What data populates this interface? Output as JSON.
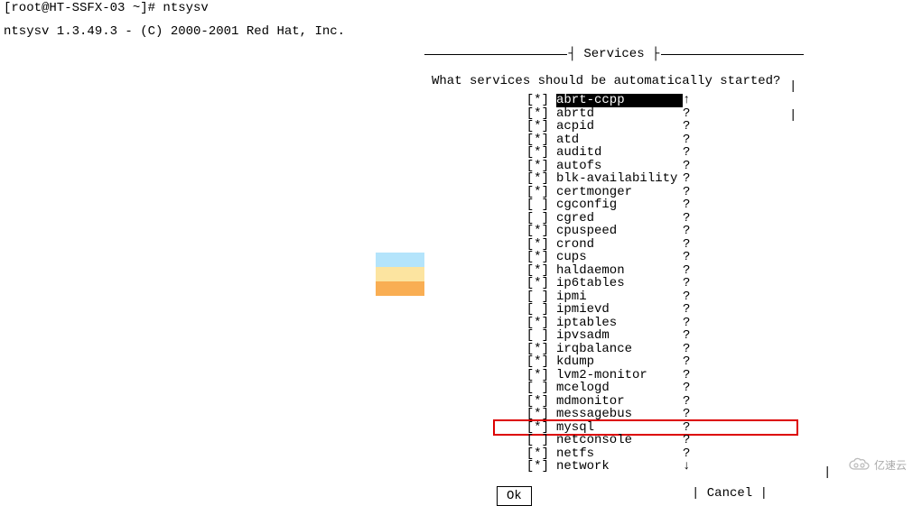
{
  "terminal": {
    "prompt_line": "[root@HT-SSFX-03 ~]# ntsysv",
    "version_line": "ntsysv 1.3.49.3 - (C) 2000-2001 Red Hat, Inc."
  },
  "dialog": {
    "title": "┤ Services ├",
    "prompt": "What services should be automatically started?",
    "services": [
      {
        "box": "[*]",
        "name": "abrt-ccpp",
        "ind": "↑",
        "selected": true,
        "highlight": false
      },
      {
        "box": "[*]",
        "name": "abrtd",
        "ind": "?",
        "selected": false,
        "highlight": false
      },
      {
        "box": "[*]",
        "name": "acpid",
        "ind": "?",
        "selected": false,
        "highlight": false
      },
      {
        "box": "[*]",
        "name": "atd",
        "ind": "?",
        "selected": false,
        "highlight": false
      },
      {
        "box": "[*]",
        "name": "auditd",
        "ind": "?",
        "selected": false,
        "highlight": false
      },
      {
        "box": "[*]",
        "name": "autofs",
        "ind": "?",
        "selected": false,
        "highlight": false
      },
      {
        "box": "[*]",
        "name": "blk-availability",
        "ind": "?",
        "selected": false,
        "highlight": false
      },
      {
        "box": "[*]",
        "name": "certmonger",
        "ind": "?",
        "selected": false,
        "highlight": false
      },
      {
        "box": "[ ]",
        "name": "cgconfig",
        "ind": "?",
        "selected": false,
        "highlight": false
      },
      {
        "box": "[ ]",
        "name": "cgred",
        "ind": "?",
        "selected": false,
        "highlight": false
      },
      {
        "box": "[*]",
        "name": "cpuspeed",
        "ind": "?",
        "selected": false,
        "highlight": false
      },
      {
        "box": "[*]",
        "name": "crond",
        "ind": "?",
        "selected": false,
        "highlight": false
      },
      {
        "box": "[*]",
        "name": "cups",
        "ind": "?",
        "selected": false,
        "highlight": false
      },
      {
        "box": "[*]",
        "name": "haldaemon",
        "ind": "?",
        "selected": false,
        "highlight": false
      },
      {
        "box": "[*]",
        "name": "ip6tables",
        "ind": "?",
        "selected": false,
        "highlight": false
      },
      {
        "box": "[ ]",
        "name": "ipmi",
        "ind": "?",
        "selected": false,
        "highlight": false
      },
      {
        "box": "[ ]",
        "name": "ipmievd",
        "ind": "?",
        "selected": false,
        "highlight": false
      },
      {
        "box": "[*]",
        "name": "iptables",
        "ind": "?",
        "selected": false,
        "highlight": false
      },
      {
        "box": "[ ]",
        "name": "ipvsadm",
        "ind": "?",
        "selected": false,
        "highlight": false
      },
      {
        "box": "[*]",
        "name": "irqbalance",
        "ind": "?",
        "selected": false,
        "highlight": false
      },
      {
        "box": "[*]",
        "name": "kdump",
        "ind": "?",
        "selected": false,
        "highlight": false
      },
      {
        "box": "[*]",
        "name": "lvm2-monitor",
        "ind": "?",
        "selected": false,
        "highlight": false
      },
      {
        "box": "[ ]",
        "name": "mcelogd",
        "ind": "?",
        "selected": false,
        "highlight": false
      },
      {
        "box": "[*]",
        "name": "mdmonitor",
        "ind": "?",
        "selected": false,
        "highlight": false
      },
      {
        "box": "[*]",
        "name": "messagebus",
        "ind": "?",
        "selected": false,
        "highlight": false
      },
      {
        "box": "[*]",
        "name": "mysql",
        "ind": "?",
        "selected": false,
        "highlight": true
      },
      {
        "box": "[ ]",
        "name": "netconsole",
        "ind": "?",
        "selected": false,
        "highlight": false
      },
      {
        "box": "[*]",
        "name": "netfs",
        "ind": "?",
        "selected": false,
        "highlight": false
      },
      {
        "box": "[*]",
        "name": "network",
        "ind": "↓",
        "selected": false,
        "highlight": false
      }
    ],
    "ok_label": "Ok",
    "cancel_label": " Cancel "
  },
  "pipes": {
    "p": "|"
  },
  "watermark": "亿速云"
}
